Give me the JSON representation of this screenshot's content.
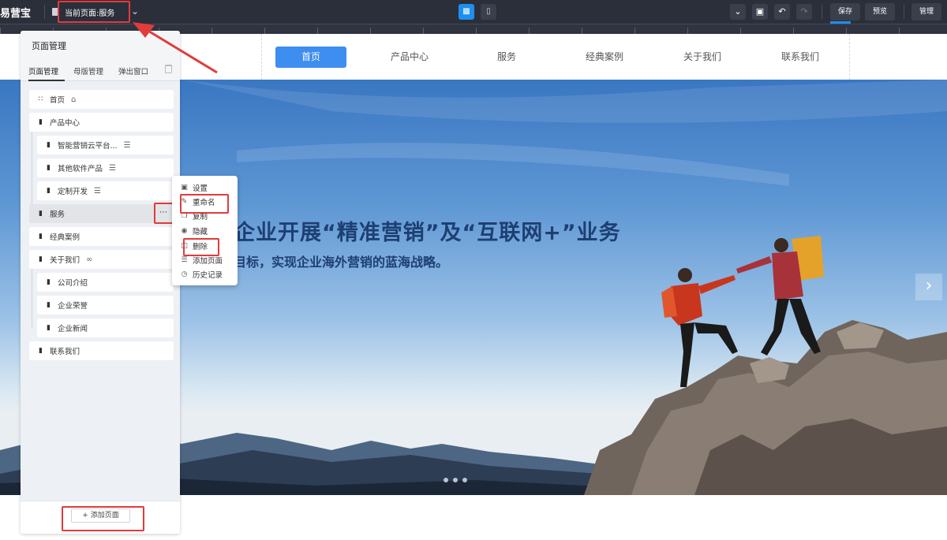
{
  "toolbar": {
    "logo": "易营宝",
    "current_page_label": "当前页面:服务",
    "save_label": "保存",
    "preview_label": "预览",
    "manage_label": "管理"
  },
  "site": {
    "nav": [
      {
        "label": "首页",
        "active": true
      },
      {
        "label": "产品中心",
        "active": false
      },
      {
        "label": "服务",
        "active": false
      },
      {
        "label": "经典案例",
        "active": false
      },
      {
        "label": "关于我们",
        "active": false
      },
      {
        "label": "联系我们",
        "active": false
      }
    ],
    "hero_title": "企业开展“精准营销”及“互联网+”业务",
    "hero_subtitle": "目标，实现企业海外营销的蓝海战略。"
  },
  "panel": {
    "title": "页面管理",
    "tabs": [
      "页面管理",
      "母版管理",
      "弹出窗口"
    ],
    "pages": [
      {
        "label": "首页",
        "icon": "grid-icon",
        "level": 0
      },
      {
        "label": "产品中心",
        "icon": "page-icon",
        "level": 0
      },
      {
        "label": "智能营销云平台...",
        "icon": "page-icon",
        "level": 1
      },
      {
        "label": "其他软件产品",
        "icon": "page-icon",
        "level": 1
      },
      {
        "label": "定制开发",
        "icon": "page-icon",
        "level": 1
      },
      {
        "label": "服务",
        "icon": "page-icon",
        "level": 0,
        "selected": true
      },
      {
        "label": "经典案例",
        "icon": "page-icon",
        "level": 0
      },
      {
        "label": "关于我们",
        "icon": "page-icon",
        "level": 0
      },
      {
        "label": "公司介绍",
        "icon": "page-icon",
        "level": 1
      },
      {
        "label": "企业荣誉",
        "icon": "page-icon",
        "level": 1
      },
      {
        "label": "企业新闻",
        "icon": "page-icon",
        "level": 1
      },
      {
        "label": "联系我们",
        "icon": "page-icon",
        "level": 0
      }
    ],
    "add_page_label": "+ 添加页面"
  },
  "context_menu": {
    "items": [
      "设置",
      "重命名",
      "复制",
      "隐藏",
      "删除",
      "添加页面",
      "历史记录"
    ]
  },
  "colors": {
    "toolbar_bg": "#2b2f3a",
    "accent": "#3d8ef0",
    "highlight_red": "#e23b3b"
  }
}
